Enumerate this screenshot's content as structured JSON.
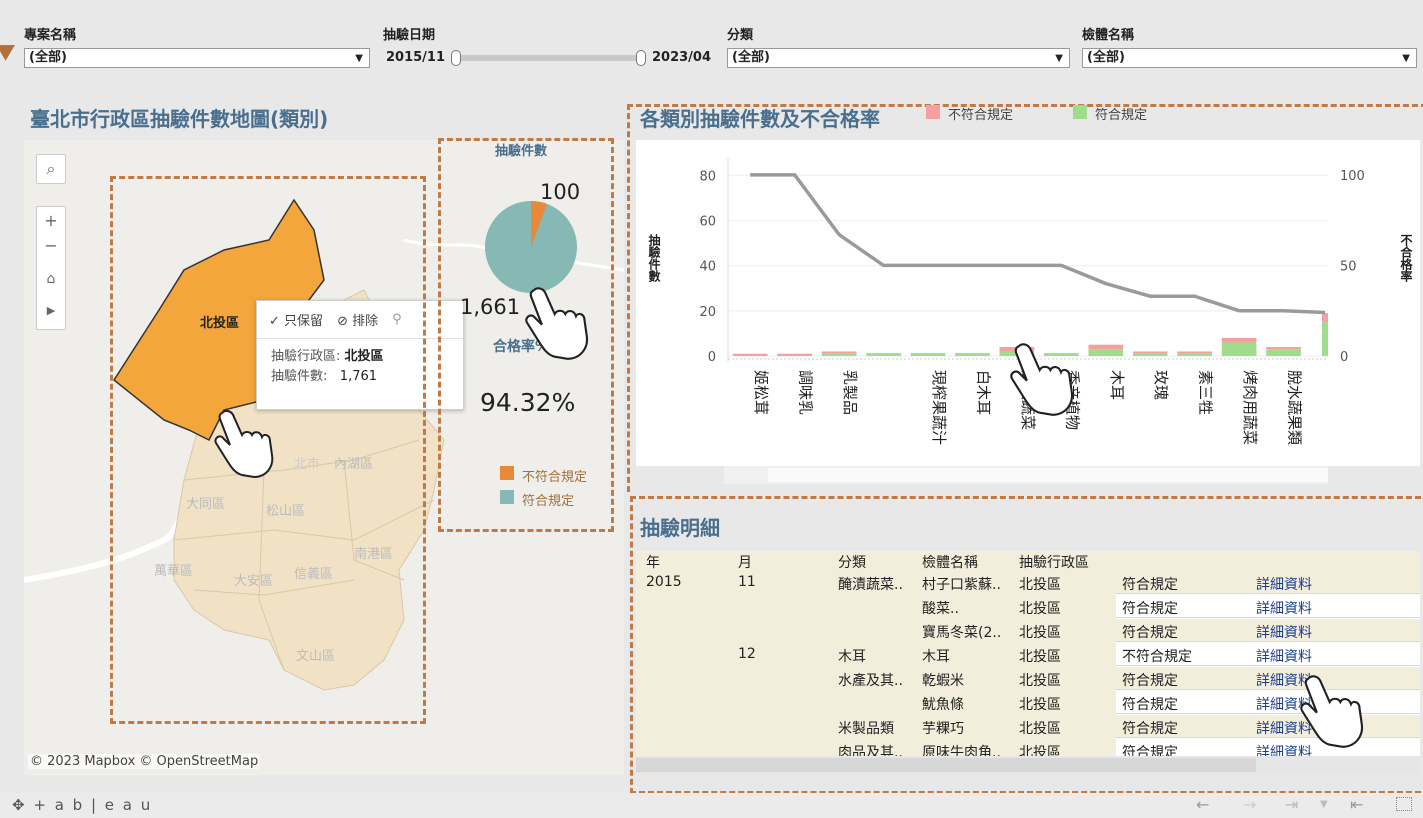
{
  "filters": {
    "project": {
      "label": "專案名稱",
      "value": "(全部)"
    },
    "date": {
      "label": "抽驗日期",
      "start": "2015/11",
      "end": "2023/04"
    },
    "category": {
      "label": "分類",
      "value": "(全部)"
    },
    "specimen": {
      "label": "檢體名稱",
      "value": "(全部)"
    }
  },
  "map_section": {
    "title": "臺北市行政區抽驗件數地圖(類別)",
    "attribution": "© 2023 Mapbox © OpenStreetMap",
    "districts": [
      "北投區",
      "士林區",
      "北市",
      "內湖區",
      "大同區",
      "松山區",
      "南港區",
      "萬華區",
      "大安區",
      "信義區",
      "文山區"
    ],
    "tooltip": {
      "keep_only": "只保留",
      "exclude": "排除",
      "district_label": "抽驗行政區:",
      "district_value": "北投區",
      "count_label": "抽驗件數:",
      "count_value": "1,761"
    }
  },
  "pie_panel": {
    "title": "抽驗件數",
    "fail_value": "100",
    "pass_value": "1,661",
    "rate_label": "合格率%",
    "rate_value": "94.32%",
    "legend": [
      {
        "label": "不符合規定",
        "color": "#e8883a"
      },
      {
        "label": "符合規定",
        "color": "#86b8b4"
      }
    ],
    "pie_fraction_fail": 0.0568
  },
  "bar_section": {
    "title": "各類別抽驗件數及不合格率",
    "legend": [
      {
        "label": "不符合規定",
        "color": "#f4a0a0"
      },
      {
        "label": "符合規定",
        "color": "#9fdc8c"
      }
    ]
  },
  "chart_data": {
    "type": "bar",
    "ylabel": "抽驗件數",
    "y2label": "不合格率",
    "ylim": [
      0,
      85
    ],
    "y2lim": [
      0,
      106
    ],
    "yticks": [
      "0",
      "20",
      "40",
      "60",
      "80"
    ],
    "y2ticks": [
      "0",
      "50",
      "100"
    ],
    "categories": [
      "姬松茸",
      "調味乳",
      "乳製品",
      "",
      "現榨果蔬汁",
      "白木耳",
      "醃漬蔬菜",
      "香辛植物",
      "木耳",
      "玫瑰",
      "素三牲",
      "烤肉用蔬菜",
      "脫水蔬果類",
      ""
    ],
    "series": [
      {
        "name": "符合規定",
        "values": [
          0,
          0,
          1,
          1,
          1,
          1,
          2,
          1,
          3,
          1,
          1,
          6,
          3,
          15
        ]
      },
      {
        "name": "不符合規定",
        "values": [
          1,
          1,
          1,
          0.3,
          0.3,
          0.3,
          2,
          0.3,
          2,
          1,
          1,
          2,
          1,
          4
        ]
      }
    ],
    "rate_line": [
      100,
      100,
      67,
      50,
      50,
      50,
      50,
      50,
      40,
      33,
      33,
      25,
      25,
      24
    ]
  },
  "detail_section": {
    "title": "抽驗明細",
    "headers": [
      "年",
      "月",
      "分類",
      "檢體名稱",
      "抽驗行政區"
    ],
    "rows": [
      {
        "year": "2015",
        "month": "11",
        "category": "醃漬蔬菜..",
        "specimen": "村子口紫蘇..",
        "district": "北投區",
        "result": "符合規定",
        "link": "詳細資料"
      },
      {
        "year": "",
        "month": "",
        "category": "",
        "specimen": "酸菜..",
        "district": "北投區",
        "result": "符合規定",
        "link": "詳細資料"
      },
      {
        "year": "",
        "month": "",
        "category": "",
        "specimen": "寶馬冬菜(2..",
        "district": "北投區",
        "result": "符合規定",
        "link": "詳細資料"
      },
      {
        "year": "",
        "month": "12",
        "category": "木耳",
        "specimen": "木耳",
        "district": "北投區",
        "result": "不符合規定",
        "link": "詳細資料"
      },
      {
        "year": "",
        "month": "",
        "category": "水產及其..",
        "specimen": "乾蝦米",
        "district": "北投區",
        "result": "符合規定",
        "link": "詳細資料"
      },
      {
        "year": "",
        "month": "",
        "category": "",
        "specimen": "魷魚條",
        "district": "北投區",
        "result": "符合規定",
        "link": "詳細資料"
      },
      {
        "year": "",
        "month": "",
        "category": "米製品類",
        "specimen": "芋粿巧",
        "district": "北投區",
        "result": "符合規定",
        "link": "詳細資料"
      },
      {
        "year": "",
        "month": "",
        "category": "肉品及其..",
        "specimen": "原味牛肉角..",
        "district": "北投區",
        "result": "符合規定",
        "link": "詳細資料"
      }
    ]
  },
  "footer": {
    "logo": "+ a b | e a u"
  }
}
